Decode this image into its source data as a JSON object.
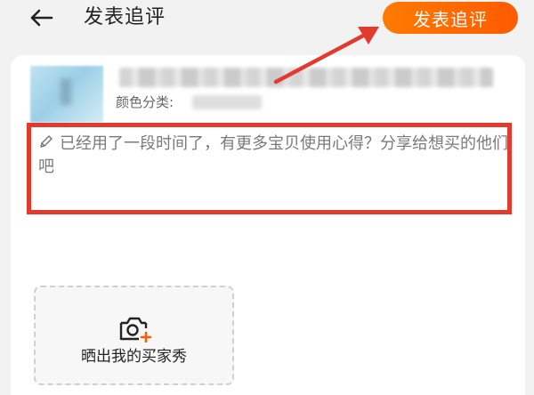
{
  "header": {
    "back_icon": "back-arrow-icon",
    "title": "发表追评",
    "submit_label": "发表追评",
    "submit_color": "#ff6a00"
  },
  "product": {
    "spec_label": "颜色分类:"
  },
  "review": {
    "placeholder": "已经用了一段时间了，有更多宝贝使用心得？分享给想买的他们吧",
    "highlight_color": "#e23b2e"
  },
  "upload": {
    "icon": "camera-plus-icon",
    "label": "晒出我的买家秀"
  }
}
